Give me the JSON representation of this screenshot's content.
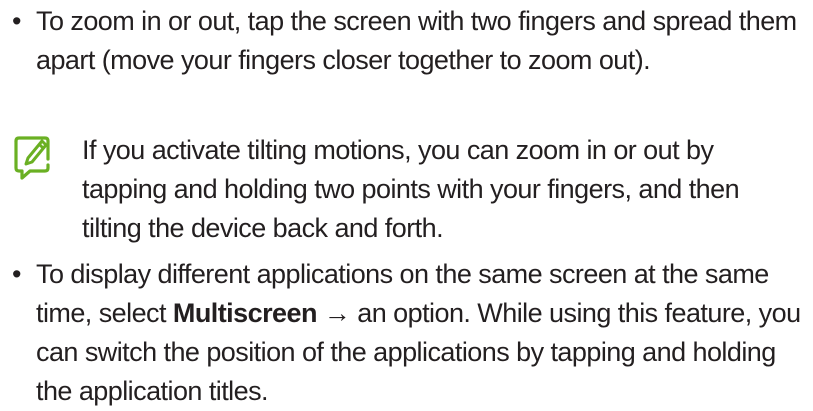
{
  "bullets": [
    {
      "text": "To zoom in or out, tap the screen with two fingers and spread them apart (move your fingers closer together to zoom out)."
    },
    {
      "text_before": "To display different applications on the same screen at the same time, select ",
      "bold": "Multiscreen",
      "text_after": " → an option. While using this feature, you can switch the position of the applications by tapping and holding the application titles."
    }
  ],
  "note": {
    "icon": "note-pencil-icon",
    "icon_color": "#6ab023",
    "text": "If you activate tilting motions, you can zoom in or out by tapping and holding two points with your fingers, and then tilting the device back and forth."
  },
  "bullet_glyph": "•"
}
